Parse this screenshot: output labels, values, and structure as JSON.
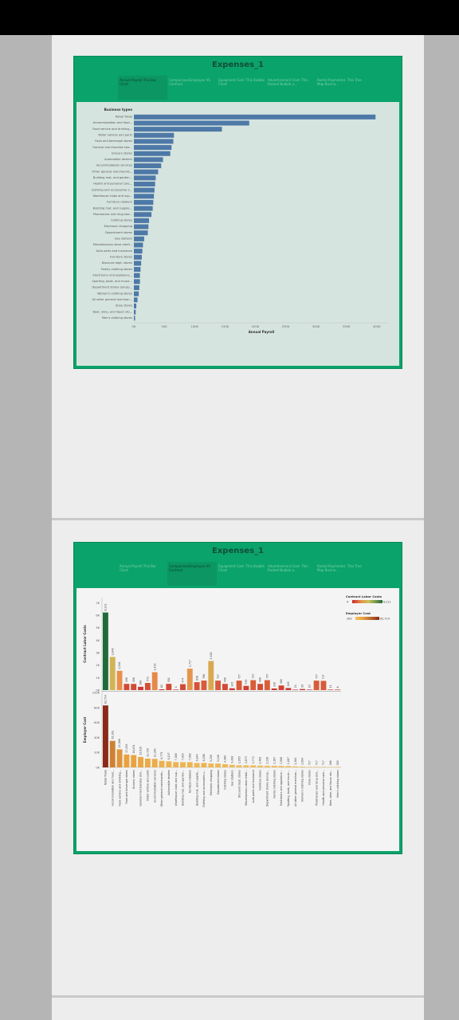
{
  "dashboards": [
    {
      "title": "Expenses_1",
      "tabs": [
        {
          "label": "Annual Payroll This Bar Chart",
          "active": true
        },
        {
          "label": "Comparison(Employee VS Contract",
          "active": false
        },
        {
          "label": "Equipment Cost- This Bubble Chart",
          "active": false
        },
        {
          "label": "Advertisement Cost- This Packed Bubble a...",
          "active": false
        },
        {
          "label": "Rental Payments(- This Tree Map Busine...",
          "active": false
        }
      ]
    },
    {
      "title": "Expenses_1",
      "tabs": [
        {
          "label": "Annual Payroll This Bar Chart",
          "active": false
        },
        {
          "label": "Comparison(Employee VS Contract",
          "active": true
        },
        {
          "label": "Equipment Cost- This Bubble Chart",
          "active": false
        },
        {
          "label": "Advertisement Cost- This Packed Bubble a...",
          "active": false
        },
        {
          "label": "Rental Payments(- This Tree Map Busine...",
          "active": false
        }
      ]
    }
  ],
  "chart_data": [
    {
      "type": "bar",
      "orientation": "horizontal",
      "header": "Business types",
      "xlabel": "Annual Payroll",
      "xlim": [
        0,
        420000
      ],
      "xticks": [
        "0K",
        "50K",
        "100K",
        "150K",
        "200K",
        "250K",
        "300K",
        "350K",
        "400K"
      ],
      "color": "#4e79a7",
      "categories": [
        "Retail Trade",
        "Accommodation and food...",
        "Food service and drinking...",
        "Motor vehicle and parts",
        "Food and beverage stores",
        "General merchandise stor...",
        "Grocery stores",
        "Automobile dealers",
        "Accommodation services",
        "Other general merchandis...",
        "Building mat. and garden...",
        "Health and personal care...",
        "Clothing and accessories s...",
        "Warehouse clubs and sup...",
        "Furniture retailers",
        "Building mat. and supplie...",
        "Pharmacies and drug stor...",
        "Clothing stores",
        "Electronic shopping",
        "Department stores",
        "Gas stations",
        "Miscellaneous store retail...",
        "Auto parts and insurance",
        "Furniture stores",
        "Discount dept. stores",
        "Family clothing stores",
        "Electronics and appliance...",
        "Sporting, book, and music...",
        "Department stores (excep...",
        "Women's clothing stores",
        "All other general merchan...",
        "Shoe stores",
        "Beer, wine, and liquor sto...",
        "Men's clothing stores"
      ],
      "values": [
        398000,
        190000,
        145000,
        66000,
        65000,
        62000,
        60000,
        48000,
        45000,
        40000,
        36000,
        35000,
        34000,
        33000,
        32000,
        31000,
        29000,
        25000,
        24000,
        23000,
        17000,
        15000,
        14000,
        13000,
        12000,
        11000,
        10000,
        10000,
        9000,
        8000,
        6000,
        4000,
        3000,
        2000
      ]
    },
    {
      "type": "bar",
      "title": "",
      "panels": [
        {
          "ylabel": "Contract Labor Costs",
          "yticks": [
            "7K",
            "6K",
            "5K",
            "4K",
            "3K",
            "2K",
            "1K",
            "0K"
          ],
          "ylim": [
            0,
            7400
          ],
          "legend_title": "Contract Labor Costs",
          "legend_min": "4",
          "legend_max": "6,211",
          "label_prefix_first": "6,211",
          "values": [
            6211,
            2649,
            1546,
            498,
            496,
            268,
            572,
            1433,
            62,
            501,
            4,
            474,
            1717,
            636,
            766,
            2326,
            757,
            498,
            145,
            757,
            339,
            797,
            496,
            797,
            128,
            368,
            165,
            24,
            85,
            20,
            757,
            737,
            11,
            6
          ],
          "labels": [
            "6,211",
            "2,649",
            "1,546",
            "498",
            "496",
            "268",
            "572",
            "1,433",
            "62",
            "501",
            "4",
            "474",
            "1,717",
            "636",
            "766",
            "2,326",
            "757",
            "498",
            "145",
            "757",
            "339",
            "797",
            "496",
            "797",
            "128",
            "368",
            "165",
            "24",
            "85",
            "20",
            "757",
            "737",
            "11",
            "6"
          ]
        },
        {
          "ylabel": "Employer Cost",
          "yticks": [
            "100K",
            "80K",
            "60K",
            "40K",
            "20K",
            "0K"
          ],
          "ylim": [
            0,
            100000
          ],
          "legend_title": "Employer Cost",
          "legend_min": "263",
          "legend_max": "62,714",
          "values": [
            82714,
            35392,
            24086,
            17228,
            16431,
            13919,
            11720,
            11391,
            8779,
            8107,
            7088,
            7020,
            7062,
            5844,
            6006,
            5258,
            5148,
            4360,
            3488,
            2905,
            2873,
            2772,
            2465,
            2236,
            2167,
            1986,
            1867,
            1384,
            1084,
            717,
            717,
            717,
            268,
            263
          ],
          "labels": [
            "82,714",
            "35,392",
            "24,086",
            "17,228",
            "16,431",
            "13,919",
            "11,720",
            "11,391",
            "8,779",
            "8,107",
            "7,088",
            "7,020",
            "7,062",
            "5,844",
            "6,006",
            "5,258",
            "5,148",
            "4,360",
            "3,488",
            "2,905",
            "2,873",
            "2,772",
            "2,465",
            "2,236",
            "2,167",
            "1,986",
            "1,867",
            "1,384",
            "1,084",
            "717",
            "717",
            "717",
            "268",
            "263"
          ]
        }
      ],
      "categories": [
        "Retail Trade",
        "Accommodation and food...",
        "Food service and drinking...",
        "Food and beverage stores",
        "Grocery stores",
        "General merchandise stor...",
        "Motor vehicle and parts",
        "Accommodation services",
        "Other general merchandis...",
        "Automobile dealers",
        "Warehouse clubs and sup...",
        "Building mat. and garden...",
        "Furniture retailers",
        "Building mat. and supplie...",
        "Clothing and accessories s...",
        "Electronic shopping",
        "Department stores",
        "Clothing stores",
        "Gas stations",
        "Discount dept. stores",
        "Miscellaneous store retail...",
        "Auto parts and insurance",
        "Furniture stores",
        "Department stores (excep...",
        "Family clothing stores",
        "Electronics and appliance...",
        "Sporting, book, and music...",
        "All other general merchan...",
        "Women's clothing stores",
        "Shoe stores",
        "Pharmacies and drug stor...",
        "Health and personal care...",
        "Beer, wine, and liquor sto...",
        "Men's clothing stores"
      ]
    }
  ]
}
